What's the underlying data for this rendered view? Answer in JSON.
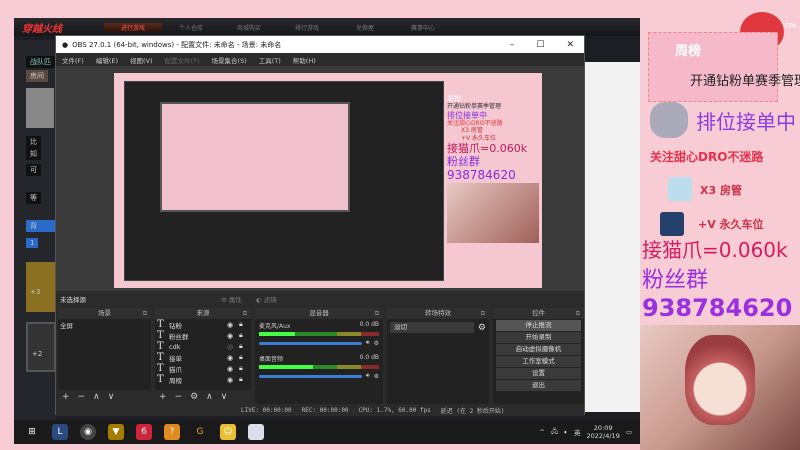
{
  "game": {
    "logo": "穿越火线",
    "tabs": [
      "进行游戏",
      "个人仓库",
      "商城购买",
      "排行游戏",
      "兑换屋",
      "赛事中心"
    ],
    "side": {
      "team": "战队匹",
      "room": "房间",
      "labels": [
        "比",
        "知",
        "可",
        "等"
      ],
      "backpack": "背",
      "slot": "1",
      "ammo1": "+3",
      "ammo2": "+2"
    }
  },
  "obs": {
    "title": "OBS 27.0.1 (64-bit, windows) - 配置文件: 未命名 - 场景: 未命名",
    "menu": [
      "文件(F)",
      "编辑(E)",
      "视图(V)",
      "配置文件(P)",
      "场景集合(S)",
      "工具(T)",
      "帮助(H)"
    ],
    "no_source": "未选择源",
    "properties": "属性",
    "filters": "滤镜",
    "docks": {
      "scenes": "场景",
      "sources": "来源",
      "mixer": "混音器",
      "transitions": "转场特效",
      "controls": "控件"
    },
    "scenes": [
      "全屏"
    ],
    "sources": [
      "钻粉",
      "粉丝群",
      "cdk",
      "接单",
      "猫爪",
      "周榜"
    ],
    "mixer": [
      {
        "name": "麦克风/Aux",
        "db": "0.0 dB"
      },
      {
        "name": "桌面音频",
        "db": "0.0 dB"
      }
    ],
    "transition": "淡切",
    "controls": [
      "停止推流",
      "开始录制",
      "启动虚拟摄像机",
      "工作室模式",
      "设置",
      "退出"
    ],
    "status": {
      "live": "LIVE: 00:00:00",
      "rec": "REC: 00:00:00",
      "cpu": "CPU: 1.7%, 60.00 fps",
      "delay": "延迟 (在 2 秒后开始)"
    }
  },
  "taskbar": {
    "time": "20:09",
    "date": "2022/4/19",
    "ime": "英"
  },
  "overlay": {
    "watermark": "DOUYU.COM",
    "weekly": "周榜",
    "line1": "开通钻粉单赛季管理",
    "line2": "排位接单中",
    "line3": "关注甜心DRO不迷路",
    "gift1": "X3 房管",
    "gift2": "+V 永久车位",
    "claw": "接猫爪=0.060k",
    "fans": "粉丝群",
    "qq": "938784620"
  },
  "colors": {
    "pink": "#f7ccd5",
    "purple": "#9b30e0",
    "red": "#d8204a"
  }
}
